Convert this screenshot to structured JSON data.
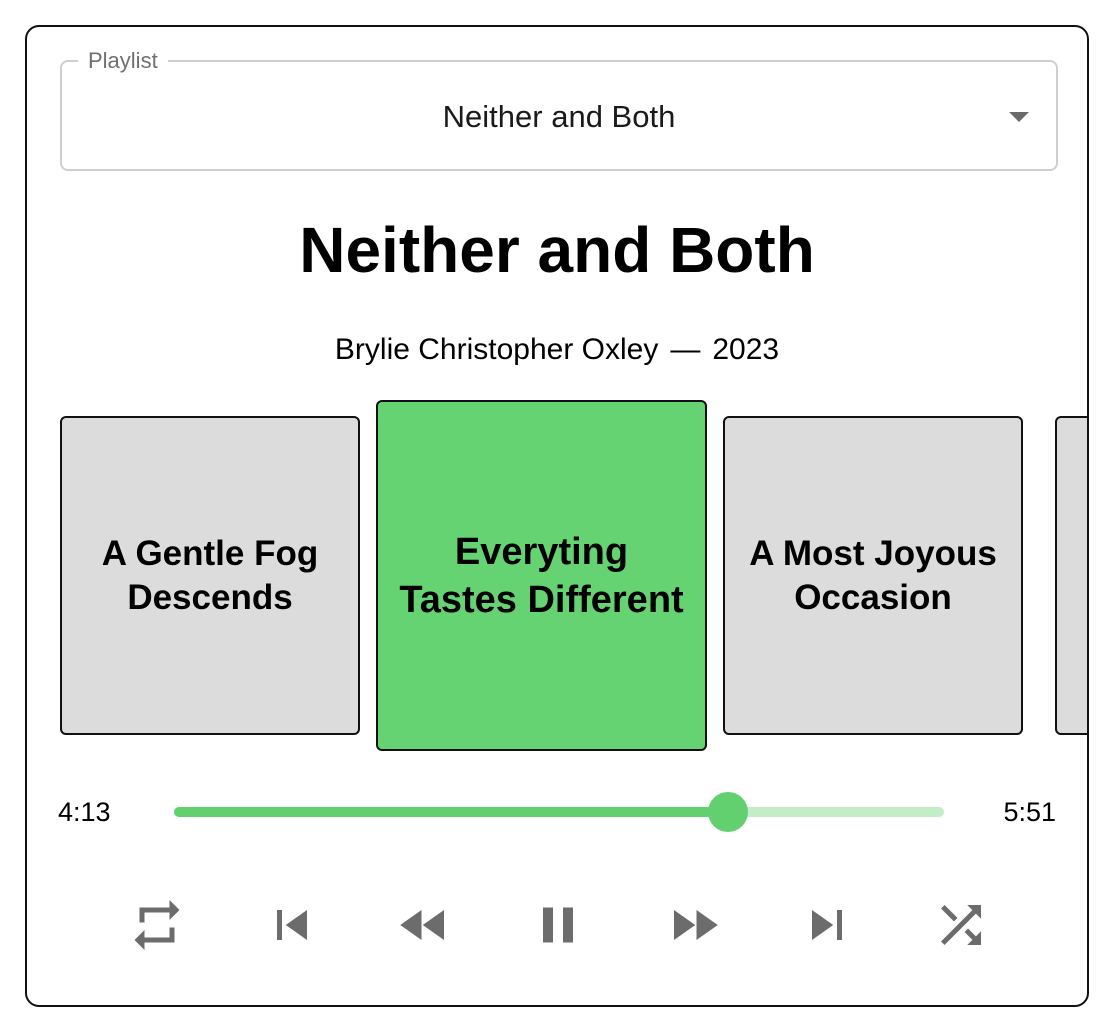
{
  "playlist": {
    "label": "Playlist",
    "selected": "Neither and Both"
  },
  "album": {
    "title": "Neither and Both",
    "artist": "Brylie Christopher Oxley",
    "separator": "—",
    "year": "2023"
  },
  "tracks": [
    {
      "title": "A Gentle Fog Descends",
      "active": false
    },
    {
      "title": "Everyting Tastes Different",
      "active": true
    },
    {
      "title": "A Most Joyous Occasion",
      "active": false
    },
    {
      "title": "",
      "active": false
    }
  ],
  "progress": {
    "current": "4:13",
    "total": "5:51",
    "fraction": 0.72
  },
  "controls": [
    {
      "name": "repeat-icon"
    },
    {
      "name": "skip-previous-icon"
    },
    {
      "name": "rewind-icon"
    },
    {
      "name": "pause-icon"
    },
    {
      "name": "fast-forward-icon"
    },
    {
      "name": "skip-next-icon"
    },
    {
      "name": "shuffle-icon"
    }
  ],
  "colors": {
    "accent": "#62d06e",
    "accent_light": "#c2edc7",
    "active_card": "#66d373",
    "card": "#dcdcdc",
    "icon": "#6c6c6c"
  }
}
